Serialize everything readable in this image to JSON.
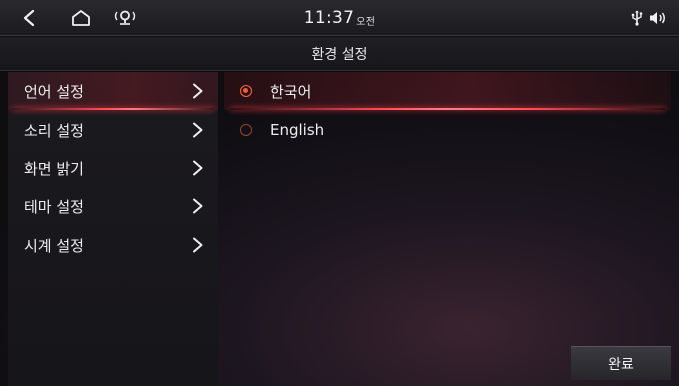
{
  "status_bar": {
    "time": "11:37",
    "ampm": "오전",
    "icons": [
      "back-icon",
      "home-icon",
      "location-signal-icon",
      "usb-icon",
      "volume-icon"
    ]
  },
  "title": "환경 설정",
  "menu": {
    "items": [
      {
        "label": "언어 설정",
        "selected": true
      },
      {
        "label": "소리 설정",
        "selected": false
      },
      {
        "label": "화면 밝기",
        "selected": false
      },
      {
        "label": "테마 설정",
        "selected": false
      },
      {
        "label": "시계 설정",
        "selected": false
      }
    ]
  },
  "options": {
    "items": [
      {
        "label": "한국어",
        "selected": true
      },
      {
        "label": "English",
        "selected": false
      }
    ]
  },
  "done_label": "완료",
  "colors": {
    "accent": "#ff4b55",
    "radio": "#ff5a2a"
  }
}
